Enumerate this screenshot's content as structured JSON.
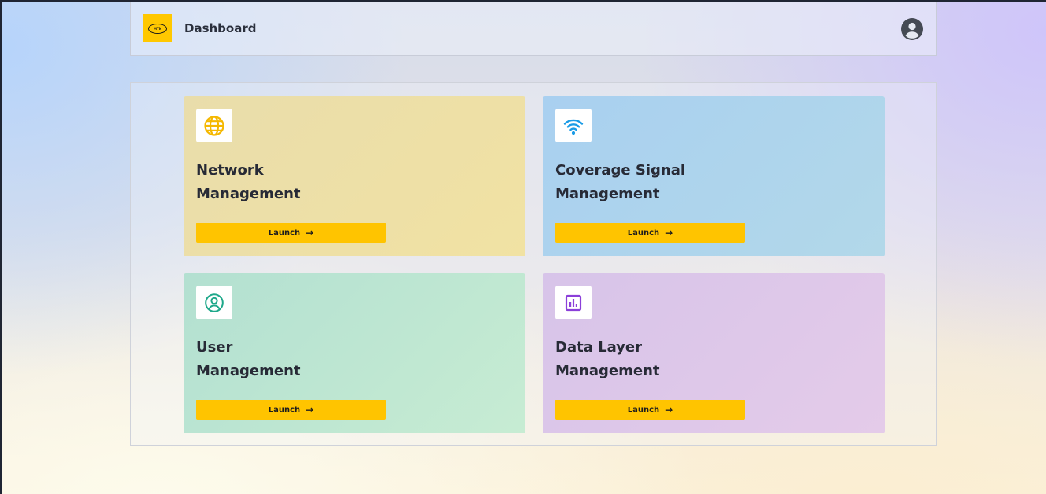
{
  "header": {
    "logo_text": "MTN",
    "title": "Dashboard",
    "avatar_icon": "account-circle-icon"
  },
  "cards": [
    {
      "title_line1": "Network",
      "title_line2": "Management",
      "icon": "globe-icon",
      "icon_color": "#f5b800",
      "button_label": "Launch",
      "button_icon": "arrow-right-icon"
    },
    {
      "title_line1": "Coverage Signal",
      "title_line2": "Management",
      "icon": "wifi-icon",
      "icon_color": "#1a9be6",
      "button_label": "Launch",
      "button_icon": "arrow-right-icon"
    },
    {
      "title_line1": "User",
      "title_line2": "Management",
      "icon": "user-circle-icon",
      "icon_color": "#1ea88a",
      "button_label": "Launch",
      "button_icon": "arrow-right-icon"
    },
    {
      "title_line1": "Data Layer",
      "title_line2": "Management",
      "icon": "chart-box-icon",
      "icon_color": "#8b3fd9",
      "button_label": "Launch",
      "button_icon": "arrow-right-icon"
    }
  ],
  "colors": {
    "brand_yellow": "#ffc800",
    "button_yellow": "#ffc400"
  }
}
